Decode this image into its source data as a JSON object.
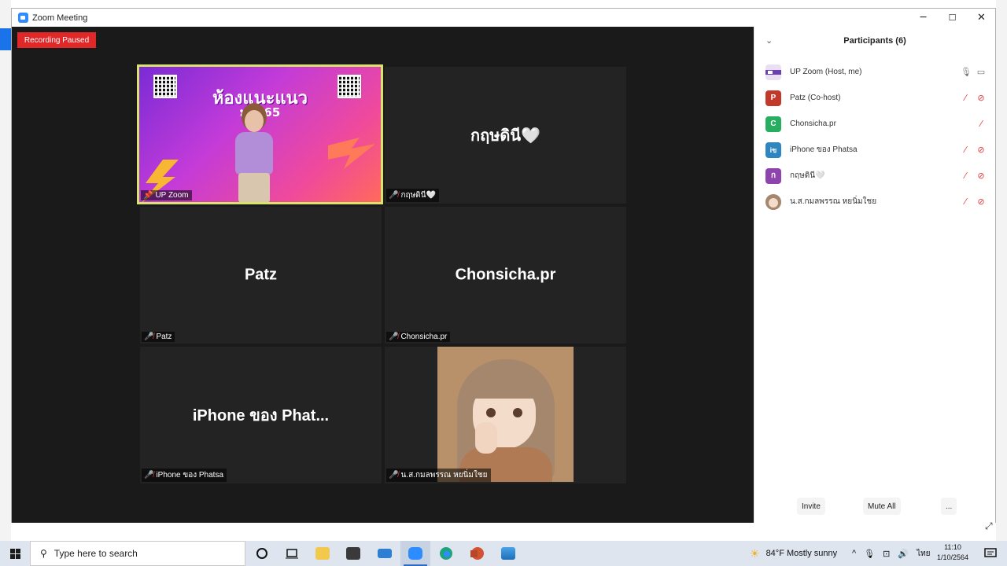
{
  "window": {
    "title": "Zoom Meeting",
    "minimize": "─",
    "maximize": "☐",
    "close": "✕"
  },
  "recording": {
    "label": "Recording Paused"
  },
  "banner": {
    "title": "ห้องแนะแนว",
    "subtitle": "มพ. 65"
  },
  "tiles": [
    {
      "big_name": "",
      "label": "UP Zoom"
    },
    {
      "big_name": "กฤษดินี🤍",
      "label": "กฤษดินี🤍"
    },
    {
      "big_name": "Patz",
      "label": "Patz"
    },
    {
      "big_name": "Chonsicha.pr",
      "label": "Chonsicha.pr"
    },
    {
      "big_name": "iPhone ของ Phat...",
      "label": "iPhone ของ Phatsa"
    },
    {
      "big_name": "",
      "label": "น.ส.กมลพรรณ หยนิ่มใชย"
    }
  ],
  "participants": {
    "title": "Participants (6)",
    "collapse_icon": "⌄",
    "items": [
      {
        "name": "UP Zoom (Host, me)",
        "initial": "",
        "color": "#e9e0f2"
      },
      {
        "name": "Patz (Co-host)",
        "initial": "P",
        "color": "#c0392b"
      },
      {
        "name": "Chonsicha.pr",
        "initial": "C",
        "color": "#27ae60"
      },
      {
        "name": "iPhone ของ Phatsa",
        "initial": "iข",
        "color": "#2e86c1"
      },
      {
        "name": "กฤษดินี🤍",
        "initial": "ก",
        "color": "#8e44ad"
      },
      {
        "name": "น.ส.กมลพรรณ หยนิ่มใชย",
        "initial": "",
        "color": "#d9b8a0"
      }
    ],
    "invite_label": "Invite",
    "mute_all_label": "Mute All",
    "more_label": "..."
  },
  "taskbar": {
    "search_placeholder": "Type here to search",
    "weather": "84°F  Mostly sunny",
    "language": "ไทย",
    "time": "11:10",
    "date": "1/10/2564"
  },
  "colors": {
    "recording": "#e02828",
    "active_speaker_border": "#d7e36a",
    "muted": "#e0393e"
  }
}
